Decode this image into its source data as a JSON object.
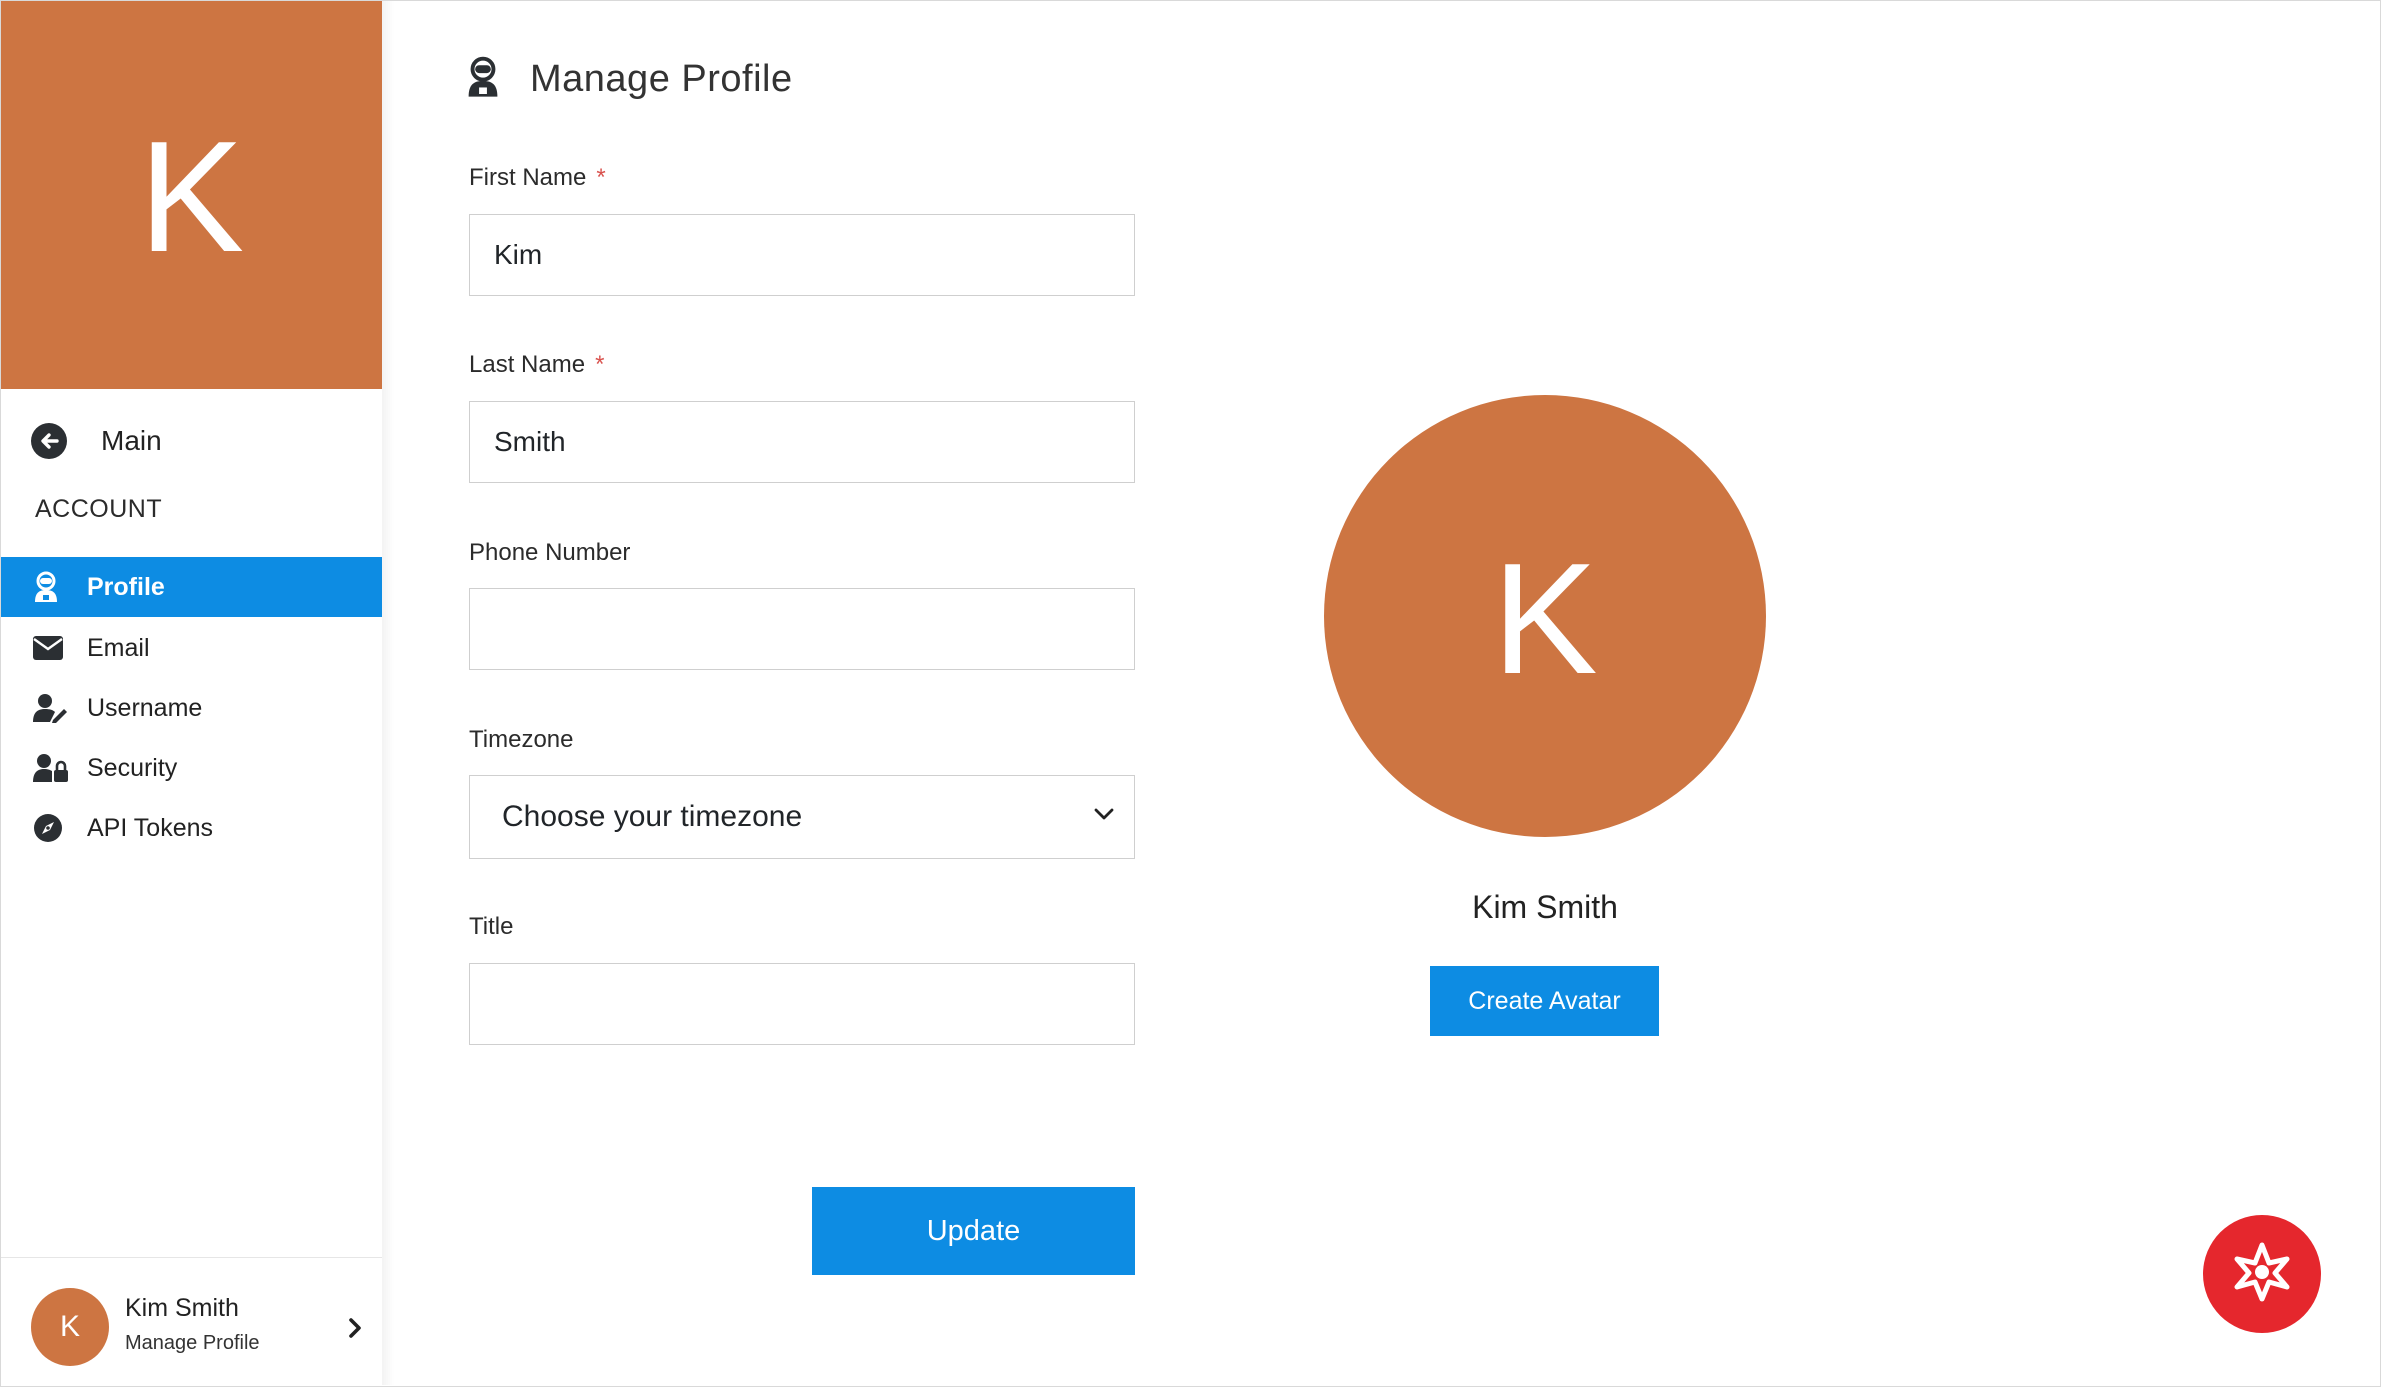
{
  "sidebar": {
    "avatar_initial": "K",
    "main_label": "Main",
    "section_heading": "ACCOUNT",
    "items": [
      {
        "label": "Profile",
        "icon": "user-robot-icon",
        "active": true
      },
      {
        "label": "Email",
        "icon": "envelope-icon",
        "active": false
      },
      {
        "label": "Username",
        "icon": "user-edit-icon",
        "active": false
      },
      {
        "label": "Security",
        "icon": "user-lock-icon",
        "active": false
      },
      {
        "label": "API Tokens",
        "icon": "compass-icon",
        "active": false
      }
    ],
    "footer": {
      "initial": "K",
      "name": "Kim Smith",
      "subtitle": "Manage Profile"
    }
  },
  "page": {
    "title": "Manage Profile",
    "icon": "user-robot-icon"
  },
  "form": {
    "first_name": {
      "label": "First Name",
      "required_mark": "*",
      "value": "Kim"
    },
    "last_name": {
      "label": "Last Name",
      "required_mark": "*",
      "value": "Smith"
    },
    "phone": {
      "label": "Phone Number",
      "value": ""
    },
    "timezone": {
      "label": "Timezone",
      "selected": "Choose your timezone"
    },
    "title": {
      "label": "Title",
      "value": ""
    },
    "update_label": "Update"
  },
  "profile_card": {
    "initial": "K",
    "name": "Kim Smith",
    "create_avatar_label": "Create Avatar"
  },
  "colors": {
    "accent": "#0d8ce3",
    "avatar": "#cd7542",
    "help_button": "#e5272d",
    "required": "#d9534f"
  }
}
